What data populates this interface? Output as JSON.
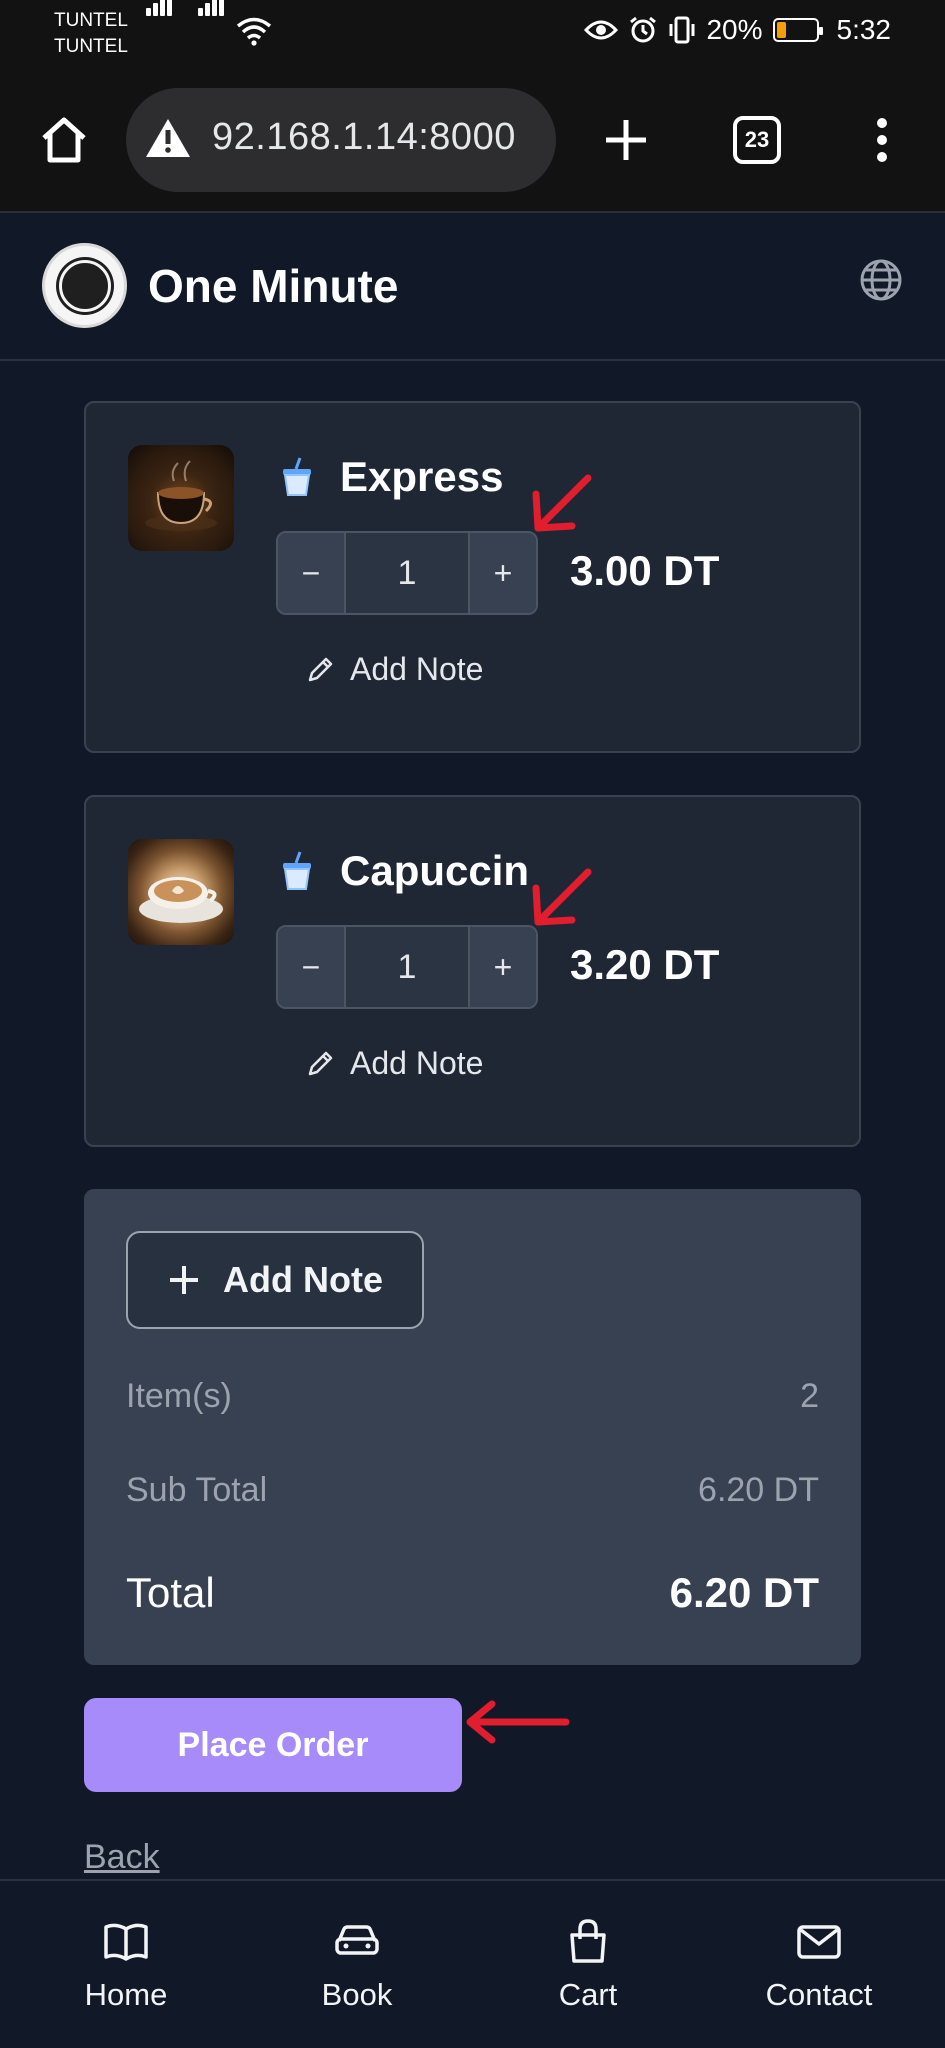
{
  "status_bar": {
    "carrier_1": "TUNTEL",
    "carrier_2": "TUNTEL",
    "battery": "20%",
    "time": "5:32",
    "battery_color": "#f59e0b"
  },
  "browser": {
    "url": "92.168.1.14:8000",
    "tab_count": "23",
    "icons": [
      "home-icon",
      "warning-icon",
      "plus-icon",
      "tabs-icon",
      "kebab-menu-icon"
    ]
  },
  "header": {
    "title": "One Minute",
    "icons": [
      "logo",
      "globe-icon"
    ]
  },
  "cart": {
    "items": [
      {
        "name": "Express",
        "quantity": "1",
        "price": "3.00 DT",
        "decrement": "−",
        "increment": "+",
        "note_label": "Add Note"
      },
      {
        "name": "Capuccin",
        "quantity": "1",
        "price": "3.20 DT",
        "decrement": "−",
        "increment": "+",
        "note_label": "Add Note"
      }
    ]
  },
  "summary": {
    "add_note_label": "Add Note",
    "items_label": "Item(s)",
    "items_value": "2",
    "subtotal_label": "Sub Total",
    "subtotal_value": "6.20 DT",
    "total_label": "Total",
    "total_value": "6.20 DT"
  },
  "actions": {
    "place_order": "Place Order",
    "back": "Back",
    "accent_color": "#a78bfa",
    "annotation_arrow_color": "#e11d2e"
  },
  "bottom_nav": {
    "items": [
      {
        "label": "Home",
        "icon": "book-open-icon"
      },
      {
        "label": "Book",
        "icon": "car-icon"
      },
      {
        "label": "Cart",
        "icon": "shopping-bag-icon"
      },
      {
        "label": "Contact",
        "icon": "mail-icon"
      }
    ]
  }
}
